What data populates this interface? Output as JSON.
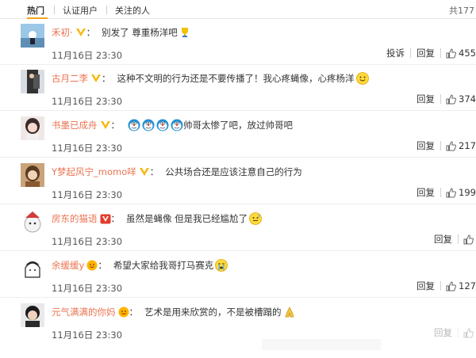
{
  "tabs": {
    "hot": "热门",
    "verified": "认证用户",
    "following": "关注的人"
  },
  "total_count": "共177",
  "comments": [
    {
      "user": "禾初·",
      "badge": "V-gold",
      "text": "别发了 尊重杨洋吧",
      "emoji": "trophy",
      "time": "11月16日 23:30",
      "report": "投诉",
      "reply": "回复",
      "likes": "455"
    },
    {
      "user": "古月二李",
      "badge": "V-gold",
      "text": "这种不文明的行为还是不要传播了！我心疼蝇像，心疼杨洋",
      "emoji": "smile-yellow",
      "time": "11月16日 23:30",
      "reply": "回复",
      "likes": "374"
    },
    {
      "user": "书墨已成舟",
      "badge": "V-gold",
      "text": "帅哥太惨了吧，放过帅哥吧",
      "emoji": "doraemon",
      "time": "11月16日 23:30",
      "reply": "回复",
      "likes": "217"
    },
    {
      "user": "Y梦起风宁_momo咩",
      "badge": "V-gold",
      "text": "公共场合还是应该注意自己的行为",
      "time": "11月16日 23:30",
      "reply": "回复",
      "likes": "199"
    },
    {
      "user": "房东的猫语",
      "badge": "V-red",
      "text": "虽然是蝇像 但是我已经尴尬了",
      "emoji": "awkward",
      "time": "11月16日 23:30",
      "reply": "回复",
      "likes": ""
    },
    {
      "user": "余缓缓y",
      "badge": "face",
      "text": "希望大家给我哥打马赛克",
      "emoji": "cry",
      "time": "11月16日 23:30",
      "reply": "回复",
      "likes": "127"
    },
    {
      "user": "元气满满的你妈",
      "badge": "face",
      "text": "艺术是用来欣赏的，不是被槽蹋的",
      "emoji": "pray",
      "time": "11月16日 23:30",
      "reply": "回复",
      "likes": ""
    }
  ]
}
